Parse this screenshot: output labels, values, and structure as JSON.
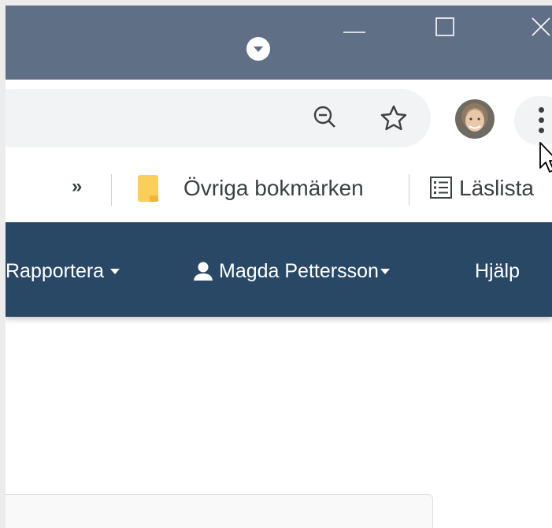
{
  "titlebar": {
    "icons": [
      "dropdown-circle-icon",
      "minimize-icon",
      "maximize-icon",
      "close-icon"
    ]
  },
  "toolbar": {
    "icons": [
      "zoom-icon",
      "bookmark-star-icon",
      "profile-avatar",
      "kebab-menu-icon"
    ]
  },
  "bookmarks": {
    "overflow_label": "»",
    "other_bookmarks_label": "Övriga bokmärken",
    "reading_list_label": "Läslista"
  },
  "nav": {
    "report_label": "Rapportera",
    "user_label": "Magda Pettersson",
    "help_label": "Hjälp"
  },
  "colors": {
    "titlebar": "#5e6f86",
    "navbar": "#294866",
    "omnibox": "#f1f3f4",
    "folder": "#fbcf5a"
  }
}
